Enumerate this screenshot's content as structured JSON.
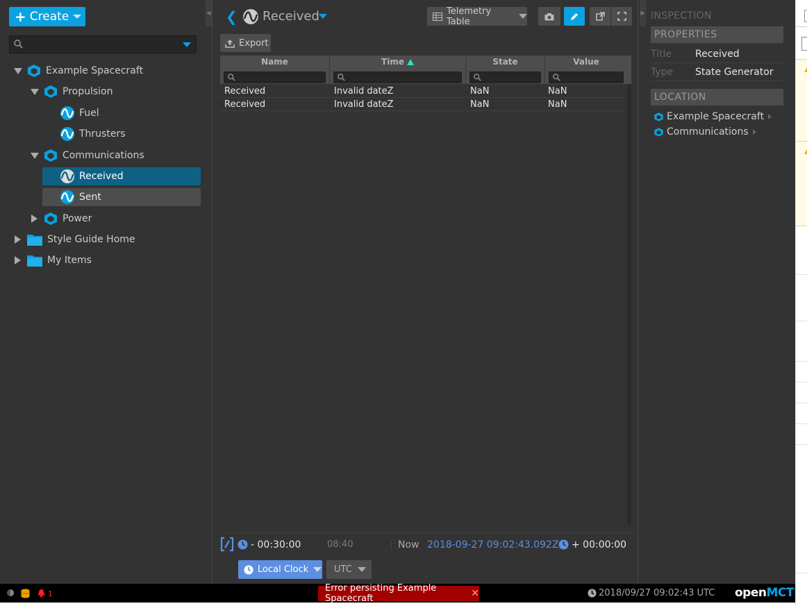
{
  "create": {
    "label": "Create"
  },
  "tree": {
    "search_placeholder": "",
    "items": [
      {
        "label": "Example Spacecraft"
      },
      {
        "label": "Propulsion"
      },
      {
        "label": "Fuel"
      },
      {
        "label": "Thrusters"
      },
      {
        "label": "Communications"
      },
      {
        "label": "Received"
      },
      {
        "label": "Sent"
      },
      {
        "label": "Power"
      },
      {
        "label": "Style Guide Home"
      },
      {
        "label": "My Items"
      }
    ]
  },
  "object": {
    "title": "Received",
    "view": "Telemetry Table",
    "export_label": "Export"
  },
  "table": {
    "columns": [
      "Name",
      "Time",
      "State",
      "Value"
    ],
    "rows": [
      [
        "Received",
        "Invalid dateZ",
        "NaN",
        "NaN"
      ],
      [
        "Received",
        "Invalid dateZ",
        "NaN",
        "NaN"
      ]
    ]
  },
  "time_conductor": {
    "start_offset": "- 00:30:00",
    "tick": "08:40",
    "now_label": "Now",
    "now_value": "2018-09-27 09:02:43.092Z",
    "end_offset": "+ 00:00:00",
    "clock_label": "Local Clock",
    "timezone": "UTC"
  },
  "inspector": {
    "title": "INSPECTION",
    "properties_header": "PROPERTIES",
    "properties": [
      {
        "key": "Title",
        "value": "Received"
      },
      {
        "key": "Type",
        "value": "State Generator"
      }
    ],
    "location_header": "LOCATION",
    "location": [
      "Example Spacecraft",
      "Communications"
    ]
  },
  "status": {
    "notification_count": "1",
    "error_message": "Error persisting Example Spacecraft",
    "clock": "2018/09/27 09:02:43 UTC",
    "logo_open": "open",
    "logo_mct": "MCT"
  },
  "colors": {
    "accent": "#0aa2e0",
    "selection": "#0e6185",
    "time_accent": "#5d8fe0",
    "error": "#a30000"
  }
}
